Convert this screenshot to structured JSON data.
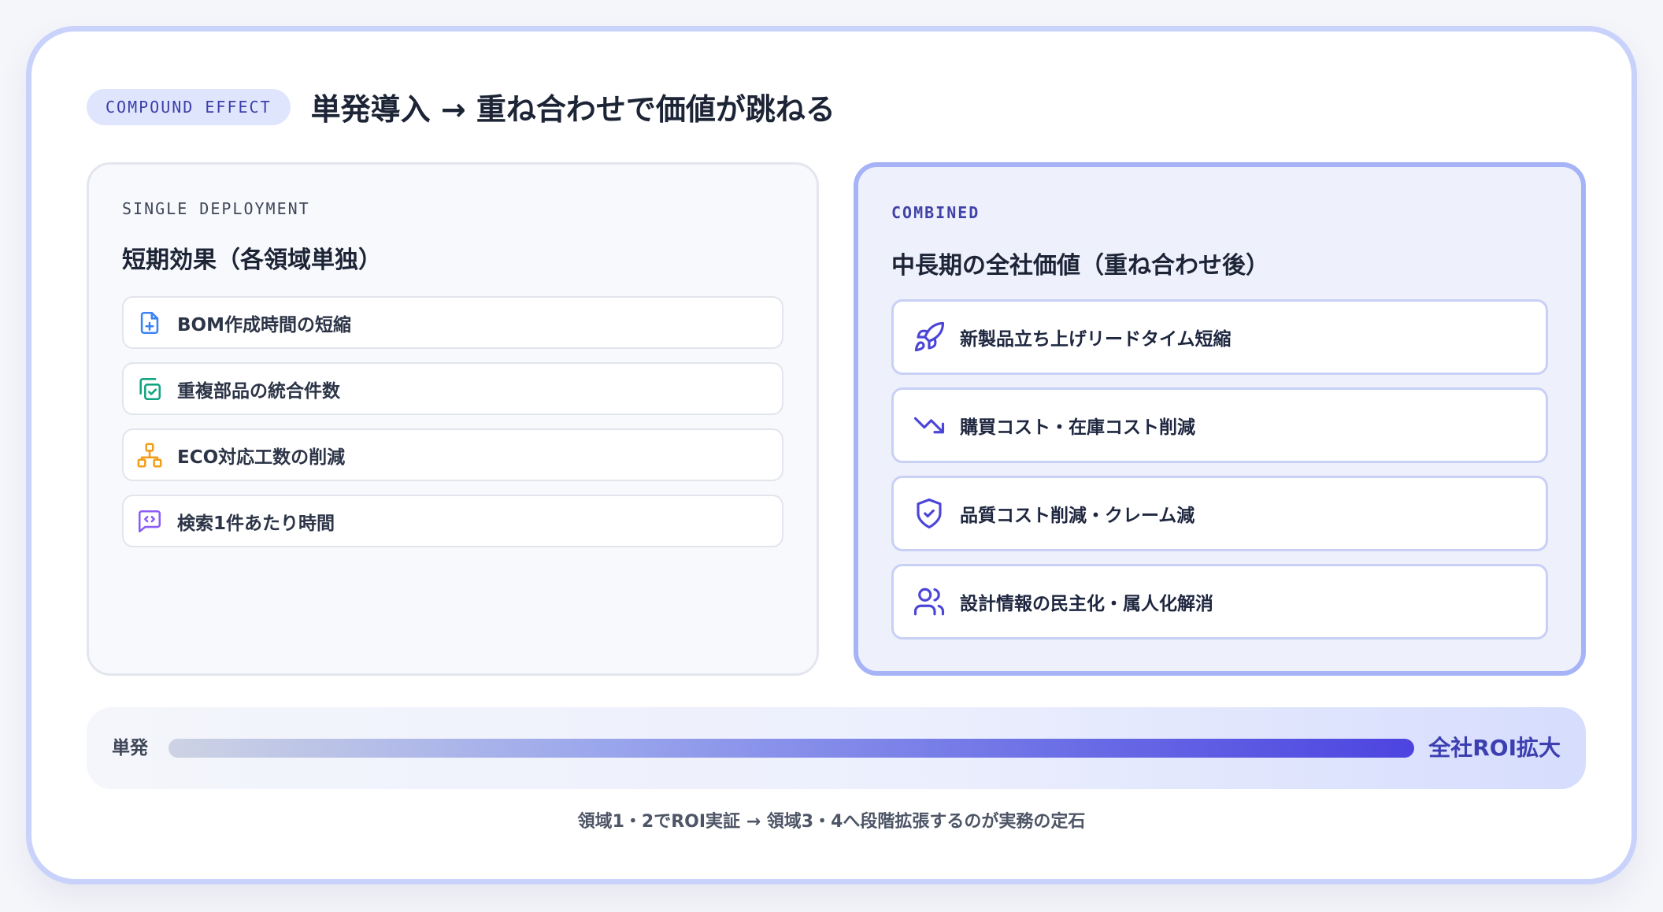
{
  "header": {
    "badge": "COMPOUND EFFECT",
    "title": "単発導入 → 重ね合わせで価値が跳ねる"
  },
  "single": {
    "eyebrow": "SINGLE DEPLOYMENT",
    "title": "短期効果（各領域単独）",
    "items": [
      {
        "label": "BOM作成時間の短縮",
        "icon": "file-plus-icon",
        "color": "#3b82f6"
      },
      {
        "label": "重複部品の統合件数",
        "icon": "copy-check-icon",
        "color": "#10a37f"
      },
      {
        "label": "ECO対応工数の削減",
        "icon": "network-icon",
        "color": "#f0a01c"
      },
      {
        "label": "検索1件あたり時間",
        "icon": "code-message-icon",
        "color": "#8b5cf6"
      }
    ]
  },
  "combined": {
    "eyebrow": "COMBINED",
    "title": "中長期の全社価値（重ね合わせ後）",
    "items": [
      {
        "label": "新製品立ち上げリードタイム短縮",
        "icon": "rocket-icon",
        "color": "#4c46d8"
      },
      {
        "label": "購買コスト・在庫コスト削減",
        "icon": "trending-down-icon",
        "color": "#4c46d8"
      },
      {
        "label": "品質コスト削減・クレーム減",
        "icon": "shield-check-icon",
        "color": "#4c46d8"
      },
      {
        "label": "設計情報の民主化・属人化解消",
        "icon": "users-icon",
        "color": "#4c46d8"
      }
    ]
  },
  "progress": {
    "start_label": "単発",
    "end_label": "全社ROI拡大",
    "value": 1.0
  },
  "footnote": "領域1・2でROI実証 → 領域3・4へ段階拡張するのが実務の定石"
}
